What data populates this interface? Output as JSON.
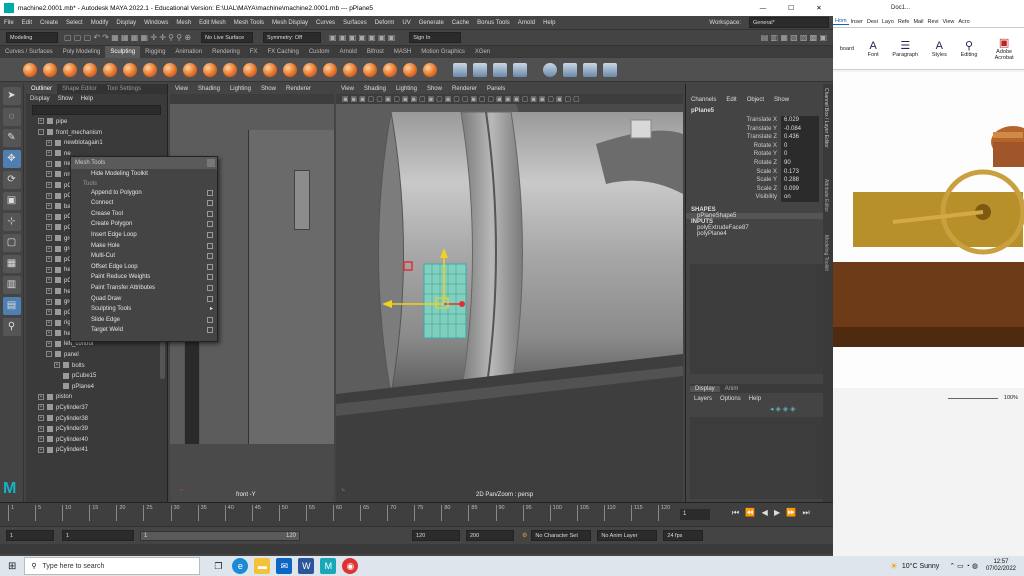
{
  "title_bar": {
    "title": "machine2.0001.mb* - Autodesk MAYA 2022.1 - Educational Version: E:\\UAL\\MAYA\\machine\\machine2.0001.mb   ---   pPlane5",
    "minimize": "—",
    "maximize": "☐",
    "close": "✕"
  },
  "menu": [
    "File",
    "Edit",
    "Create",
    "Select",
    "Modify",
    "Display",
    "Windows",
    "Mesh",
    "Edit Mesh",
    "Mesh Tools",
    "Mesh Display",
    "Curves",
    "Surfaces",
    "Deform",
    "UV",
    "Generate",
    "Cache",
    "Bonus Tools",
    "Arnold",
    "Help"
  ],
  "workspace": {
    "label": "Workspace:",
    "value": "General*"
  },
  "status_line": {
    "mode": "Modeling",
    "live_surface": "No Live Surface",
    "symmetry": "Symmetry: Off",
    "sign_in": "Sign In"
  },
  "shelf_tabs": [
    "Curves / Surfaces",
    "Poly Modeling",
    "Sculpting",
    "Rigging",
    "Animation",
    "Rendering",
    "FX",
    "FX Caching",
    "Custom",
    "Arnold",
    "Bifrost",
    "MASH",
    "Motion Graphics",
    "XGen"
  ],
  "shelf_active": "Sculpting",
  "outliner": {
    "tabs": [
      "Outliner",
      "Shape Editor",
      "Tool Settings"
    ],
    "menu": [
      "Display",
      "Show",
      "Help"
    ],
    "items": [
      {
        "indent": 1,
        "name": "pipe",
        "expand": "+"
      },
      {
        "indent": 1,
        "name": "front_mechanism",
        "expand": "-"
      },
      {
        "indent": 2,
        "name": "newblotagain1",
        "expand": "+"
      },
      {
        "indent": 2,
        "name": "ne",
        "expand": "+"
      },
      {
        "indent": 2,
        "name": "ne",
        "expand": "+"
      },
      {
        "indent": 2,
        "name": "nn",
        "expand": "+"
      },
      {
        "indent": 2,
        "name": "pC",
        "expand": "+"
      },
      {
        "indent": 2,
        "name": "pC",
        "expand": "+"
      },
      {
        "indent": 2,
        "name": "ba",
        "expand": "+"
      },
      {
        "indent": 2,
        "name": "pC",
        "expand": "+"
      },
      {
        "indent": 2,
        "name": "pC",
        "expand": "+"
      },
      {
        "indent": 2,
        "name": "gro",
        "expand": "+"
      },
      {
        "indent": 2,
        "name": "gro",
        "expand": "+"
      },
      {
        "indent": 2,
        "name": "pC",
        "expand": "+"
      },
      {
        "indent": 2,
        "name": "he",
        "expand": "+"
      },
      {
        "indent": 2,
        "name": "pC",
        "expand": "+"
      },
      {
        "indent": 2,
        "name": "he",
        "expand": "+"
      },
      {
        "indent": 2,
        "name": "gro",
        "expand": "+"
      },
      {
        "indent": 2,
        "name": "pCylinder34",
        "expand": "+"
      },
      {
        "indent": 2,
        "name": "right_control",
        "expand": "+"
      },
      {
        "indent": 2,
        "name": "hex_blot2",
        "expand": "+"
      },
      {
        "indent": 2,
        "name": "left_control",
        "expand": "+"
      },
      {
        "indent": 2,
        "name": "panel",
        "expand": "-"
      },
      {
        "indent": 3,
        "name": "bolts",
        "expand": "+"
      },
      {
        "indent": 3,
        "name": "pCube15",
        "expand": ""
      },
      {
        "indent": 3,
        "name": "pPlane4",
        "expand": ""
      },
      {
        "indent": 1,
        "name": "piston",
        "expand": "+"
      },
      {
        "indent": 1,
        "name": "pCylinder37",
        "expand": "+"
      },
      {
        "indent": 1,
        "name": "pCylinder38",
        "expand": "+"
      },
      {
        "indent": 1,
        "name": "pCylinder39",
        "expand": "+"
      },
      {
        "indent": 1,
        "name": "pCylinder40",
        "expand": "+"
      },
      {
        "indent": 1,
        "name": "pCylinder41",
        "expand": "+"
      }
    ]
  },
  "mesh_tools_menu": {
    "title": "Mesh Tools",
    "hide": "Hide Modeling Toolkit",
    "section": "Tools",
    "items": [
      "Append to Polygon",
      "Connect",
      "Crease Tool",
      "Create Polygon",
      "Insert Edge Loop",
      "Make Hole",
      "Multi-Cut",
      "Offset Edge Loop",
      "Paint Reduce Weights",
      "Paint Transfer Attributes",
      "Quad Draw",
      "Sculpting Tools",
      "Slide Edge",
      "Target Weld"
    ],
    "submenu_arrow": "▸"
  },
  "viewport_left": {
    "menu": [
      "View",
      "Shading",
      "Lighting",
      "Show",
      "Renderer"
    ],
    "label": "front -Y"
  },
  "viewport_main": {
    "menu": [
      "View",
      "Shading",
      "Lighting",
      "Show",
      "Renderer",
      "Panels"
    ],
    "label": "2D Pan/Zoom : persp"
  },
  "channel_box": {
    "menu": [
      "Channels",
      "Edit",
      "Object",
      "Show"
    ],
    "object": "pPlane5",
    "attributes": [
      {
        "name": "Translate X",
        "value": "6.029"
      },
      {
        "name": "Translate Y",
        "value": "-0.084"
      },
      {
        "name": "Translate Z",
        "value": "0.436"
      },
      {
        "name": "Rotate X",
        "value": "0"
      },
      {
        "name": "Rotate Y",
        "value": "0"
      },
      {
        "name": "Rotate Z",
        "value": "90"
      },
      {
        "name": "Scale X",
        "value": "0.173"
      },
      {
        "name": "Scale Y",
        "value": "0.288"
      },
      {
        "name": "Scale Z",
        "value": "0.099"
      },
      {
        "name": "Visibility",
        "value": "on"
      }
    ],
    "shapes_header": "SHAPES",
    "shape": "pPlaneShape5",
    "inputs_header": "INPUTS",
    "inputs": [
      "polyExtrudeFace87",
      "polyPlane4"
    ],
    "side_tabs": [
      "Channel Box / Layer Editor",
      "Attribute Editor",
      "Modeling Toolkit"
    ]
  },
  "layer_editor": {
    "tabs": [
      "Display",
      "Anim"
    ],
    "menu": [
      "Layers",
      "Options",
      "Help"
    ]
  },
  "time_slider": {
    "ticks": [
      "1",
      "5",
      "10",
      "15",
      "20",
      "25",
      "30",
      "35",
      "40",
      "45",
      "50",
      "55",
      "60",
      "65",
      "70",
      "75",
      "80",
      "85",
      "90",
      "95",
      "100",
      "105",
      "110",
      "115",
      "120"
    ],
    "current": "1"
  },
  "range_slider": {
    "start": "1",
    "current": "1",
    "range_start_field": "1",
    "range_end": "120",
    "end": "120",
    "max": "200",
    "character_set": "No Character Set",
    "anim_layer": "No Anim Layer",
    "fps": "24 fps"
  },
  "word": {
    "title": "Doc1...",
    "tabs": [
      "Hom",
      "Inser",
      "Desi",
      "Layo",
      "Refe",
      "Mail",
      "Revi",
      "View",
      "Acro"
    ],
    "ribbon": [
      "Font",
      "Paragraph",
      "Styles",
      "Editing",
      "Adobe Acrobat"
    ],
    "clipboard": "board",
    "zoom": "100%"
  },
  "taskbar": {
    "search": "Type here to search",
    "weather": "10°C  Sunny",
    "time": "12:57",
    "date": "07/02/2022"
  },
  "colors": {
    "accent": "#4f7eb0",
    "selection_green": "#7fd6c4",
    "gizmo_red": "#e03030",
    "gizmo_yellow": "#f0d020"
  }
}
